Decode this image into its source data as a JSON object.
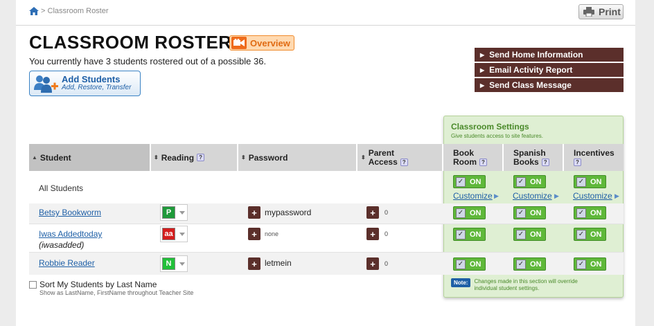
{
  "breadcrumb": {
    "separator": ">",
    "current": "Classroom Roster"
  },
  "print_label": "Print",
  "page_title": "CLASSROOM ROSTER",
  "overview_label": "Overview",
  "roster_summary": "You currently have 3 students rostered out of a possible 36.",
  "add_students": {
    "title": "Add Students",
    "subtitle": "Add, Restore, Transfer"
  },
  "actions": [
    "Send Home Information",
    "Email Activity Report",
    "Send Class Message"
  ],
  "settings": {
    "title": "Classroom Settings",
    "subtitle": "Give students access to site features.",
    "note_badge": "Note:",
    "note_text": "Changes made in this section will override individual student settings."
  },
  "columns": {
    "student": "Student",
    "reading": "Reading",
    "password": "Password",
    "parent_access_1": "Parent",
    "parent_access_2": "Access",
    "book_room_1": "Book",
    "book_room_2": "Room",
    "spanish_books_1": "Spanish",
    "spanish_books_2": "Books",
    "incentives": "Incentives",
    "help": "?"
  },
  "all_students": {
    "label": "All Students",
    "toggle": "ON",
    "customize": "Customize"
  },
  "students": [
    {
      "name": "Betsy Bookworm",
      "nickname": "",
      "level": "P",
      "level_color": "#1f9a3a",
      "password": "mypassword",
      "parent_count": "0",
      "toggle": "ON"
    },
    {
      "name": "Iwas Addedtoday",
      "nickname": "(iwasadded)",
      "level": "aa",
      "level_color": "#d41e1e",
      "password": "none",
      "parent_count": "0",
      "toggle": "ON"
    },
    {
      "name": "Robbie Reader",
      "nickname": "",
      "level": "N",
      "level_color": "#22c03a",
      "password": "letmein",
      "parent_count": "0",
      "toggle": "ON"
    }
  ],
  "sort_option": {
    "label": "Sort My Students by Last Name",
    "hint": "Show as LastName, FirstName throughout Teacher Site"
  },
  "colors": {
    "accent_brown": "#5b2f2b",
    "toggle_green": "#5fb83a",
    "link_blue": "#1e5fa6",
    "overview_orange": "#f08a2b"
  }
}
